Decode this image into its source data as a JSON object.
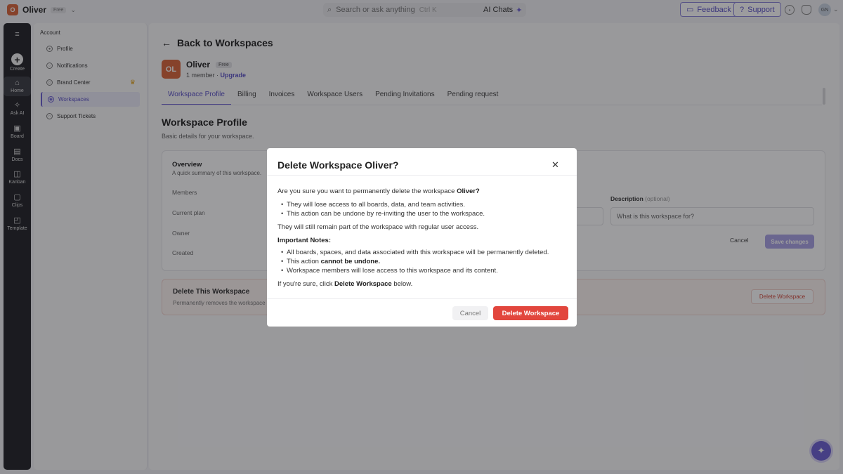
{
  "topbar": {
    "workspace_initial": "O",
    "workspace_name": "Oliver",
    "plan_badge": "Free",
    "search_placeholder": "Search or ask anything",
    "search_shortcut": "Ctrl K",
    "ai_chats_label": "AI Chats",
    "feedback_label": "Feedback",
    "support_label": "Support",
    "user_initials": "GN"
  },
  "rail": {
    "items": [
      {
        "label": "Create",
        "icon": "plus-icon"
      },
      {
        "label": "Home",
        "icon": "home-icon"
      },
      {
        "label": "Ask AI",
        "icon": "sparkle-icon"
      },
      {
        "label": "Board",
        "icon": "board-icon"
      },
      {
        "label": "Docs",
        "icon": "docs-icon"
      },
      {
        "label": "Kanban",
        "icon": "kanban-icon"
      },
      {
        "label": "Clips",
        "icon": "clips-icon"
      },
      {
        "label": "Template",
        "icon": "template-icon"
      }
    ]
  },
  "sidebar": {
    "heading": "Account",
    "items": [
      {
        "label": "Profile",
        "icon": "user-icon"
      },
      {
        "label": "Notifications",
        "icon": "bell-icon"
      },
      {
        "label": "Brand Center",
        "icon": "brand-icon"
      },
      {
        "label": "Workspaces",
        "icon": "users-icon",
        "active": true
      },
      {
        "label": "Support Tickets",
        "icon": "headset-icon"
      }
    ]
  },
  "main": {
    "back_label": "Back to Workspaces",
    "org": {
      "initials": "OL",
      "name": "Oliver",
      "badge": "Free",
      "members": "1 member",
      "separator": "·",
      "upgrade": "Upgrade"
    },
    "tabs": [
      {
        "label": "Workspace Profile",
        "active": true
      },
      {
        "label": "Billing"
      },
      {
        "label": "Invoices"
      },
      {
        "label": "Workspace Users"
      },
      {
        "label": "Pending Invitations"
      },
      {
        "label": "Pending request"
      }
    ],
    "title": "Workspace Profile",
    "subtitle": "Basic details for your workspace.",
    "overview": {
      "title": "Overview",
      "subtitle": "A quick summary of this workspace.",
      "rows": [
        "Members",
        "Current plan",
        "Owner",
        "Created"
      ],
      "description_label": "Description",
      "description_optional": "(optional)",
      "description_placeholder": "What is this workspace for?",
      "cancel_label": "Cancel",
      "save_label": "Save changes"
    },
    "danger": {
      "title": "Delete This Workspace",
      "subtitle": "Permanently removes the workspace",
      "button_label": "Delete Workspace"
    }
  },
  "modal": {
    "title": "Delete Workspace Oliver?",
    "intro": "Are you sure you want to permanently delete the workspace",
    "intro_bold": "Oliver?",
    "bullets_1": [
      "They will lose access to all boards, data, and team activities.",
      "This action can be undone by re-inviting the user to the workspace."
    ],
    "remain_text": "They will still remain part of the workspace with regular user access.",
    "notes_heading": "Important Notes:",
    "note_1": "All boards, spaces, and data associated with this workspace will be permanently deleted.",
    "note_2_prefix": "This action",
    "note_2_bold": "cannot be undone.",
    "note_3": "Workspace members will lose access to this workspace and its content.",
    "confirm_prefix": "If you're sure, click",
    "confirm_bold": "Delete Workspace",
    "confirm_suffix": "below.",
    "cancel_label": "Cancel",
    "delete_label": "Delete Workspace"
  }
}
